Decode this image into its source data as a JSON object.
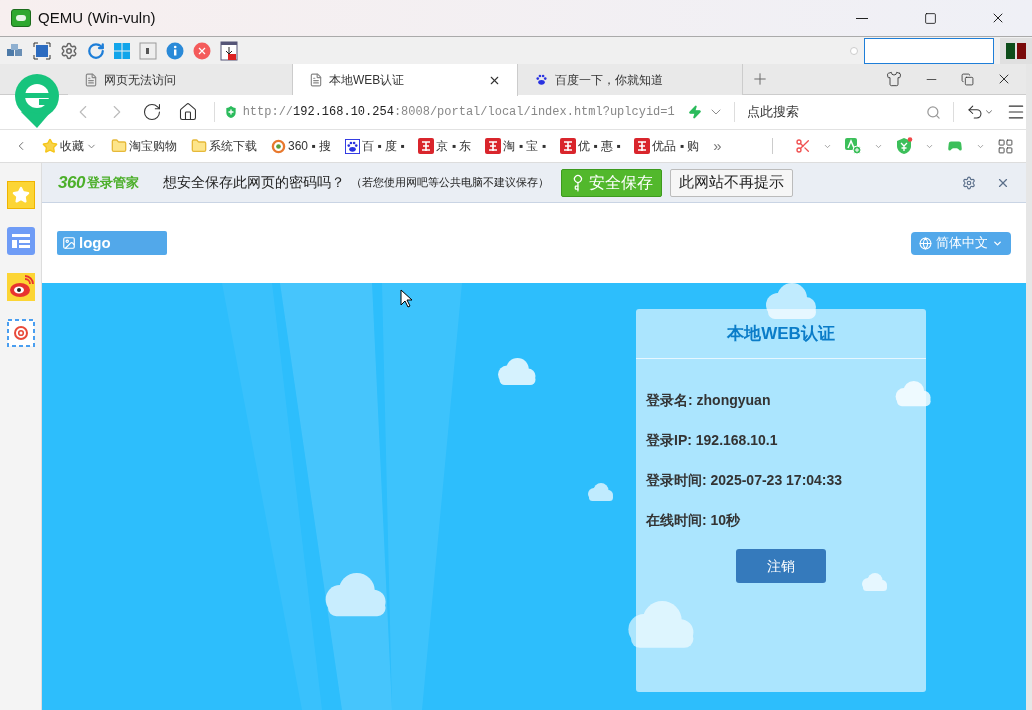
{
  "window": {
    "title": "QEMU (Win-vuln)"
  },
  "browser": {
    "tabs": [
      {
        "label": "网页无法访问",
        "selected": false
      },
      {
        "label": "本地WEB认证",
        "selected": true
      },
      {
        "label": "百度一下，你就知道",
        "selected": false
      }
    ],
    "address": {
      "scheme": "http://",
      "host": "192.168.10.254",
      "rest": ":8008/portal/local/index.html?uplcyid=1"
    },
    "search": {
      "placeholder": "点此搜索"
    },
    "bookmarks": [
      {
        "kind": "star",
        "label": "收藏"
      },
      {
        "kind": "folder",
        "label": "淘宝购物"
      },
      {
        "kind": "folder",
        "label": "系统下载"
      },
      {
        "kind": "ring",
        "label": "360 ▪ 搜"
      },
      {
        "kind": "baidu",
        "label": "百 ▪ 度 ▪"
      },
      {
        "kind": "taobao",
        "label": "京 ▪ 东"
      },
      {
        "kind": "taobao",
        "label": "淘 ▪ 宝 ▪"
      },
      {
        "kind": "taobao",
        "label": "优 ▪ 惠 ▪"
      },
      {
        "kind": "taobao",
        "label": "优品 ▪ 购"
      }
    ],
    "more": "»"
  },
  "password_bar": {
    "brand": "360",
    "brand_sub": "登录管家",
    "question": "想安全保存此网页的密码吗？",
    "note": "（若您使用网吧等公共电脑不建议保存）",
    "save": "安全保存",
    "never": "此网站不再提示"
  },
  "page": {
    "logo": "logo",
    "language": "简体中文",
    "card": {
      "title": "本地WEB认证",
      "fields": [
        "登录名: zhongyuan",
        "登录IP: 192.168.10.1",
        "登录时间: 2025-07-23 17:04:33",
        "在线时间: 10秒"
      ],
      "logout": "注销"
    }
  }
}
